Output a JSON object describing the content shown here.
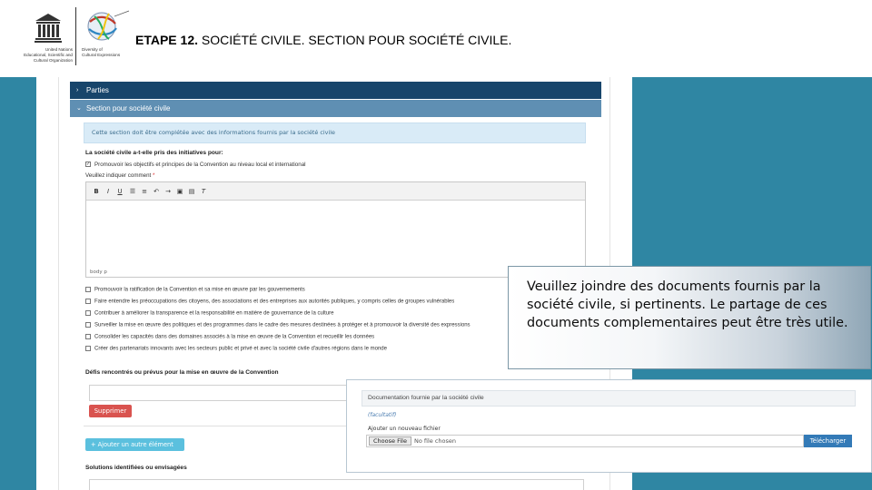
{
  "slide": {
    "title_bold": "ETAPE 12.",
    "title_rest": " SOCIÉTÉ CIVILE. SECTION POUR SOCIÉTÉ CIVILE."
  },
  "logo": {
    "unesco_line1": "United Nations",
    "unesco_line2": "Educational, Scientific and",
    "unesco_line3": "Cultural Organization",
    "diversity_line1": "Diversity of",
    "diversity_line2": "Cultural Expressions"
  },
  "accordion": {
    "parties_label": "Parties",
    "civil_society_label": "Section pour société civile"
  },
  "form": {
    "info_text": "Cette section doit être complétée avec des informations fournis par la société civile",
    "question": "La société civile a-t-elle pris des initiatives pour:",
    "checked_option": "Promouvoir les objectifs et principes de la Convention au niveau local et international",
    "specify_label": "Veuillez indiquer comment",
    "required_star": "*",
    "editor_footer": "body   p",
    "options": [
      "Promouvoir la ratification de la Convention et sa mise en œuvre par les gouvernements",
      "Faire entendre les préoccupations des citoyens, des associations et des entreprises aux autorités publiques, y compris celles de groupes vulnérables",
      "Contribuer à améliorer la transparence et la responsabilité en matière de gouvernance de la culture",
      "Surveiller la mise en œuvre des politiques et des programmes dans le cadre des mesures destinées à protéger et à promouvoir la diversité des expressions",
      "Consolider les capacités dans des domaines associés à la mise en œuvre de la Convention et recueillir les données",
      "Créer des partenariats innovants avec les secteurs public et privé et avec la société civile d'autres régions dans le monde"
    ],
    "challenges_label": "Défis rencontrés ou prévus pour la mise en œuvre de la Convention",
    "delete_label": "Supprimer",
    "add_label": "+  Ajouter un autre élément",
    "solutions_label": "Solutions identifiées ou envisagées"
  },
  "callout": {
    "text": "Veuillez joindre des documents fournis par la société civile, si pertinents. Le partage de ces documents complementaires  peut être très utile."
  },
  "upload": {
    "header": "Documentation fournie par la société civile",
    "optional": "(facultatif)",
    "add_label": "Ajouter un nouveau fichier",
    "choose_label": "Choose File",
    "no_file": "No file chosen",
    "upload_button": "Télécharger"
  },
  "colors": {
    "slide_bg": "#2f86a3",
    "accordion_dark": "#17456b",
    "accordion_light": "#5f8fb3",
    "delete_red": "#d9534f",
    "add_cyan": "#5bc0de",
    "upload_blue": "#337ab7"
  }
}
